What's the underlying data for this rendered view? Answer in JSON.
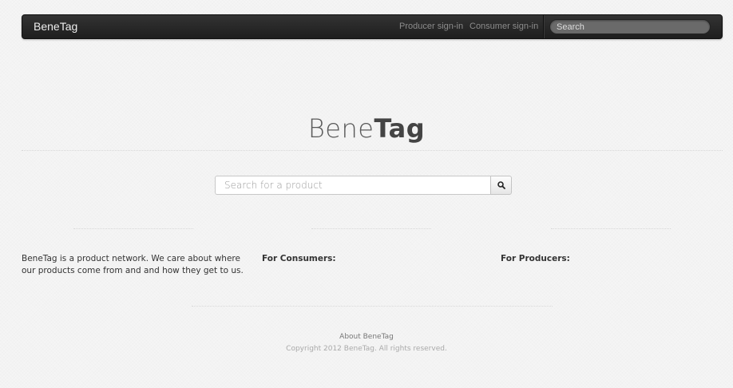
{
  "navbar": {
    "brand": "BeneTag",
    "links": {
      "producer_signin": "Producer sign-in",
      "consumer_signin": "Consumer sign-in"
    },
    "search_placeholder": "Search"
  },
  "hero": {
    "title_light": "Bene",
    "title_bold": "Tag"
  },
  "main_search": {
    "placeholder": "Search for a product",
    "button_icon": "search-icon"
  },
  "columns": {
    "about_text": "BeneTag is a product network. We care about where our products come from and and how they get to us.",
    "consumers_heading": "For Consumers:",
    "producers_heading": "For Producers:"
  },
  "footer": {
    "about_link": "About BeneTag",
    "copyright": "Copyright 2012 BeneTag. All rights reserved."
  },
  "colors": {
    "navbar_bg": "#222222",
    "page_bg": "#f5f5f5"
  }
}
